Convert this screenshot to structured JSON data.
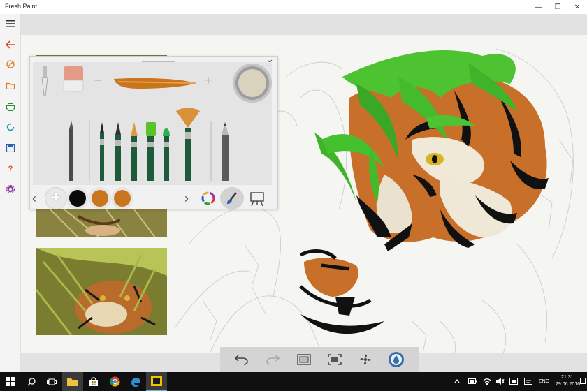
{
  "window": {
    "title": "Fresh Paint",
    "minimize_glyph": "—",
    "restore_glyph": "❐",
    "close_glyph": "✕"
  },
  "sidebar": {
    "items": [
      {
        "name": "menu-hamburger",
        "icon": "hamburger-icon"
      },
      {
        "name": "back",
        "icon": "back-arrow-icon"
      },
      {
        "name": "paint",
        "icon": "brush-icon"
      },
      {
        "name": "open",
        "icon": "folder-icon"
      },
      {
        "name": "print",
        "icon": "printer-icon"
      },
      {
        "name": "share",
        "icon": "share-icon"
      },
      {
        "name": "save",
        "icon": "save-icon"
      },
      {
        "name": "help",
        "icon": "help-icon",
        "label": "?"
      },
      {
        "name": "settings",
        "icon": "gear-icon"
      }
    ]
  },
  "tool_panel": {
    "close_glyph": "✕",
    "minus_glyph": "−",
    "plus_glyph": "+",
    "add_color_glyph": "+",
    "prev_glyph": "‹",
    "next_glyph": "›",
    "swatches": [
      "#0a0a0a",
      "#c8751e",
      "#c8751e"
    ],
    "current_paint_color": "#d8d2bf"
  },
  "bottom_toolbar": {
    "buttons": [
      "undo-icon",
      "redo-icon",
      "fit-screen-icon",
      "fullscreen-icon",
      "fan-dry-icon",
      "water-drop-icon"
    ]
  },
  "taskbar": {
    "language": "ENG",
    "time": "21:31",
    "date": "29.06.2016"
  },
  "colors": {
    "accent": "#e04a1f",
    "rail_icon_orange": "#e07a1a",
    "rail_icon_green": "#2e8b3a",
    "rail_icon_teal": "#1a9bb0",
    "rail_icon_blue": "#2b5fb0",
    "rail_icon_purple": "#8a3aa0",
    "taskbar": "#101010"
  }
}
